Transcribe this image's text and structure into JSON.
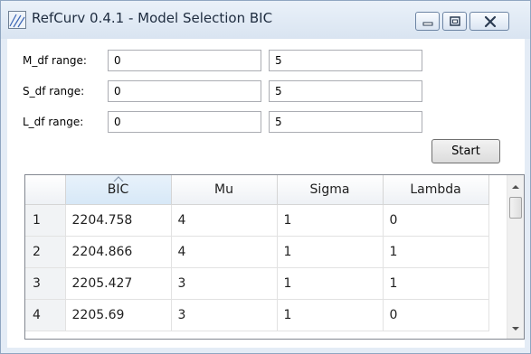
{
  "window": {
    "title": "RefCurv 0.4.1 - Model Selection BIC",
    "icon": "refcurv-app-icon",
    "controls": [
      "minimize-icon",
      "maximize-icon",
      "close-icon"
    ]
  },
  "ranges": [
    {
      "label": "M_df range:",
      "low": "0",
      "high": "5"
    },
    {
      "label": "S_df range:",
      "low": "0",
      "high": "5"
    },
    {
      "label": "L_df range:",
      "low": "0",
      "high": "5"
    }
  ],
  "start_label": "Start",
  "table": {
    "columns": [
      "BIC",
      "Mu",
      "Sigma",
      "Lambda"
    ],
    "sorted_column": "BIC",
    "rows": [
      {
        "num": "1",
        "cells": [
          "2204.758",
          "4",
          "1",
          "0"
        ]
      },
      {
        "num": "2",
        "cells": [
          "2204.866",
          "4",
          "1",
          "1"
        ]
      },
      {
        "num": "3",
        "cells": [
          "2205.427",
          "3",
          "1",
          "1"
        ]
      },
      {
        "num": "4",
        "cells": [
          "2205.69",
          "3",
          "1",
          "0"
        ]
      }
    ]
  },
  "colors": {
    "titlebar": "#dce6f2",
    "accent": "#d7e8f7"
  }
}
